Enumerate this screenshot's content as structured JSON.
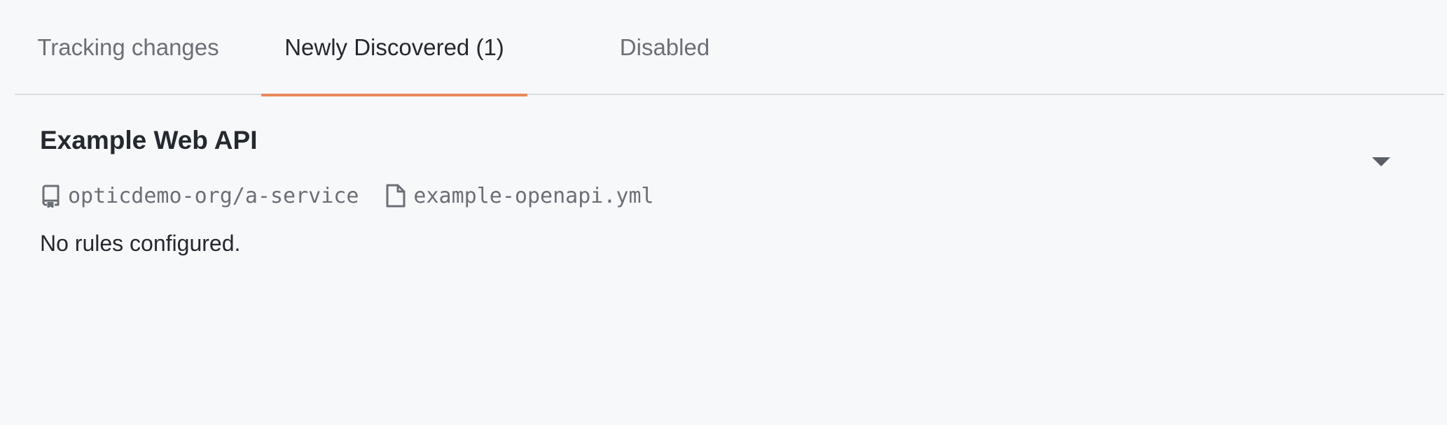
{
  "tabs": [
    {
      "label": "Tracking changes"
    },
    {
      "label": "Newly Discovered (1)"
    },
    {
      "label": "Disabled"
    }
  ],
  "active_tab": "Newly Discovered (1)",
  "accent_color": "#e8895d",
  "api": {
    "name": "Example Web API",
    "repository": "opticdemo-org/a-service",
    "file": "example-openapi.yml",
    "message": "No rules configured."
  },
  "icons": {
    "repository": "repo-icon",
    "file": "file-icon",
    "expand": "caret-down-icon"
  }
}
